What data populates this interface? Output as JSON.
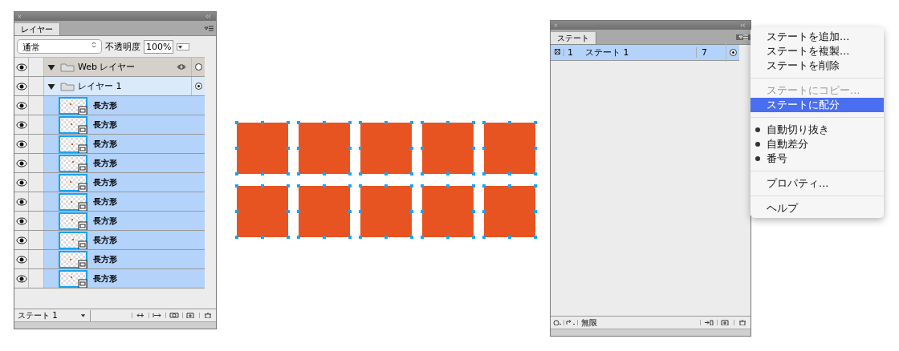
{
  "layers_panel": {
    "tab": "レイヤー",
    "blend_mode": "通常",
    "opacity_label": "不透明度",
    "opacity": "100%",
    "layers": [
      {
        "name": "Web レイヤー",
        "kind": "web",
        "expanded": true,
        "targeted": false,
        "visible": true,
        "locked": false
      },
      {
        "name": "レイヤー 1",
        "kind": "layer",
        "expanded": true,
        "targeted": true,
        "visible": true,
        "locked": false,
        "children": [
          {
            "name": "長方形",
            "kind": "object",
            "selected": true,
            "visible": true,
            "locked": false
          },
          {
            "name": "長方形",
            "kind": "object",
            "selected": true,
            "visible": true,
            "locked": false
          },
          {
            "name": "長方形",
            "kind": "object",
            "selected": true,
            "visible": true,
            "locked": false
          },
          {
            "name": "長方形",
            "kind": "object",
            "selected": true,
            "visible": true,
            "locked": false
          },
          {
            "name": "長方形",
            "kind": "object",
            "selected": true,
            "visible": true,
            "locked": false
          },
          {
            "name": "長方形",
            "kind": "object",
            "selected": true,
            "visible": true,
            "locked": false
          },
          {
            "name": "長方形",
            "kind": "object",
            "selected": true,
            "visible": true,
            "locked": false
          },
          {
            "name": "長方形",
            "kind": "object",
            "selected": true,
            "visible": true,
            "locked": false
          },
          {
            "name": "長方形",
            "kind": "object",
            "selected": true,
            "visible": true,
            "locked": false
          },
          {
            "name": "長方形",
            "kind": "object",
            "selected": true,
            "visible": true,
            "locked": false
          }
        ]
      }
    ],
    "state_select": "ステート 1"
  },
  "canvas": {
    "shapes": [
      {
        "selected": true
      },
      {
        "selected": true
      },
      {
        "selected": true
      },
      {
        "selected": true
      },
      {
        "selected": true
      },
      {
        "selected": true
      },
      {
        "selected": true
      },
      {
        "selected": true
      },
      {
        "selected": true
      },
      {
        "selected": true
      }
    ]
  },
  "states_panel": {
    "tab": "ステート",
    "states": [
      {
        "number": "1",
        "name": "ステート 1",
        "delay": "7",
        "selected": true
      }
    ],
    "loop": "無限"
  },
  "menu": {
    "groups": [
      [
        {
          "label": "ステートを追加...",
          "disabled": false,
          "selected": false,
          "checked": false
        },
        {
          "label": "ステートを複製...",
          "disabled": false,
          "selected": false,
          "checked": false
        },
        {
          "label": "ステートを削除",
          "disabled": false,
          "selected": false,
          "checked": false
        }
      ],
      [
        {
          "label": "ステートにコピー...",
          "disabled": true,
          "selected": false,
          "checked": false
        },
        {
          "label": "ステートに配分",
          "disabled": false,
          "selected": true,
          "checked": false
        }
      ],
      [
        {
          "label": "自動切り抜き",
          "disabled": false,
          "selected": false,
          "checked": true
        },
        {
          "label": "自動差分",
          "disabled": false,
          "selected": false,
          "checked": true
        },
        {
          "label": "番号",
          "disabled": false,
          "selected": false,
          "checked": true
        }
      ],
      [
        {
          "label": "プロパティ...",
          "disabled": false,
          "selected": false,
          "checked": false
        }
      ],
      [
        {
          "label": "ヘルプ",
          "disabled": false,
          "selected": false,
          "checked": false
        }
      ]
    ]
  }
}
